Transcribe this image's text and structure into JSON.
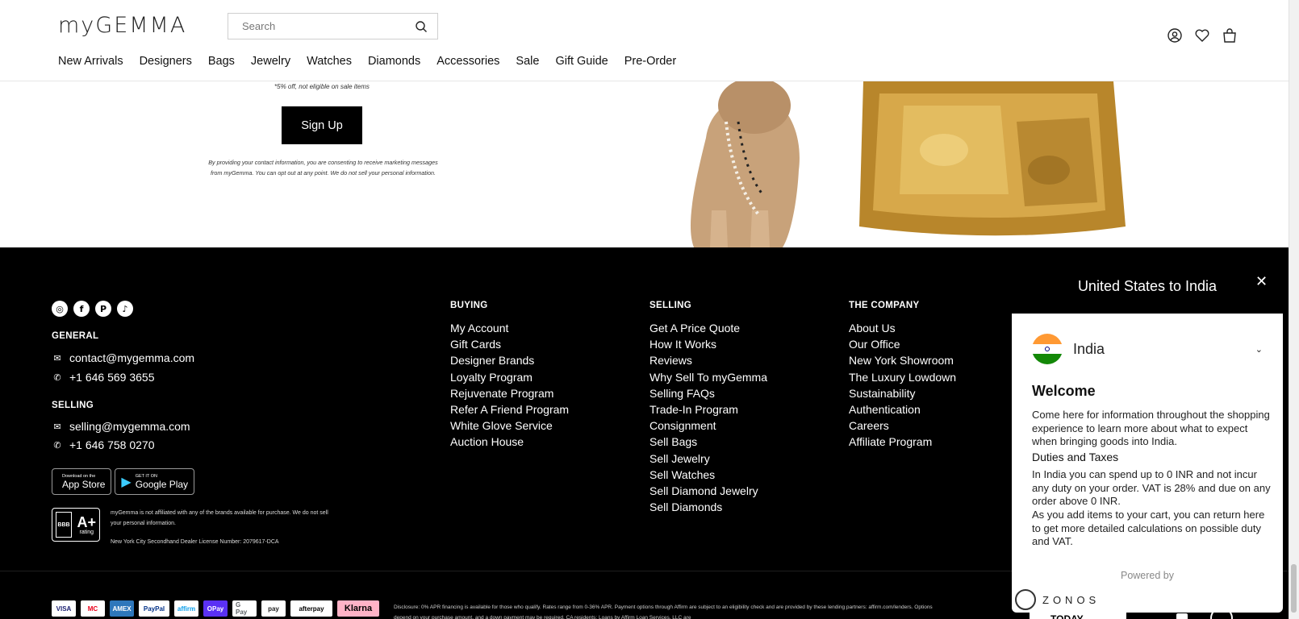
{
  "header": {
    "logo": "myGEMMA",
    "search_placeholder": "Search",
    "nav": [
      "New Arrivals",
      "Designers",
      "Bags",
      "Jewelry",
      "Watches",
      "Diamonds",
      "Accessories",
      "Sale",
      "Gift Guide",
      "Pre-Order"
    ]
  },
  "hero": {
    "offer_note": "5% off, not eligible on sale items",
    "signup_label": "Sign Up",
    "consent": "By providing your contact information, you are consenting to receive marketing messages from myGemma. You can opt out at any point. We do not sell your personal information."
  },
  "footer": {
    "social": [
      "instagram-icon",
      "facebook-icon",
      "pinterest-icon",
      "tiktok-icon"
    ],
    "general_heading": "GENERAL",
    "general_email": "contact@mygemma.com",
    "general_phone": "+1 646 569 3655",
    "selling_heading": "SELLING",
    "selling_email": "selling@mygemma.com",
    "selling_phone": "+1 646 758 0270",
    "appstore": {
      "small": "Download on the",
      "big": "App Store"
    },
    "googleplay": {
      "small": "GET IT ON",
      "big": "Google Play"
    },
    "bbb": {
      "seal": "BBB",
      "rating": "A+",
      "rating_label": "rating"
    },
    "disclaimer": "myGemma is not affiliated with any of the brands available for purchase. We do not sell your personal information.",
    "license": "New York City Secondhand Dealer License Number: 2079617-DCA",
    "buying": {
      "heading": "BUYING",
      "links": [
        "My Account",
        "Gift Cards",
        "Designer Brands",
        "Loyalty Program",
        "Rejuvenate Program",
        "Refer A Friend Program",
        "White Glove Service",
        "Auction House"
      ]
    },
    "selling": {
      "heading": "SELLING",
      "links": [
        "Get A Price Quote",
        "How It Works",
        "Reviews",
        "Why Sell To myGemma",
        "Selling FAQs",
        "Trade-In Program",
        "Consignment",
        "Sell Bags",
        "Sell Jewelry",
        "Sell Watches",
        "Sell Diamond Jewelry",
        "Sell Diamonds"
      ]
    },
    "company": {
      "heading": "THE COMPANY",
      "links": [
        "About Us",
        "Our Office",
        "New York Showroom",
        "The Luxury Lowdown",
        "Sustainability",
        "Authentication",
        "Careers",
        "Affiliate Program"
      ]
    },
    "payments": [
      "VISA",
      "MC",
      "AMEX",
      "PayPal",
      "affirm",
      "OPay",
      "G Pay",
      "pay",
      "afterpay",
      "Klarna"
    ],
    "affirm_disclosure": "Disclosure: 0% APR financing is available for those who qualify. Rates range from 0-36% APR. Payment options through Affirm are subject to an eligibility check and are provided by these lending partners: affirm.com/lenders. Options depend on your purchase amount, and a down payment may be required. CA residents: Loans by Affirm Loan Services, LLC are",
    "app_banner": "GET OUR APP TODAY"
  },
  "zonos": {
    "title": "United States to India",
    "country": "India",
    "welcome": "Welcome",
    "intro": "Come here for information throughout the shopping experience to learn more about what to expect when bringing goods into India.",
    "duties_heading": "Duties and Taxes",
    "duties_text": "In India you can spend up to 0 INR and not incur any duty on your order. VAT is 28% and due on any order above 0 INR.",
    "cart_text": "As you add items to your cart, you can return here to get more detailed calculations on possible duty and VAT.",
    "powered_by": "Powered by",
    "brand": "ZONOS"
  }
}
